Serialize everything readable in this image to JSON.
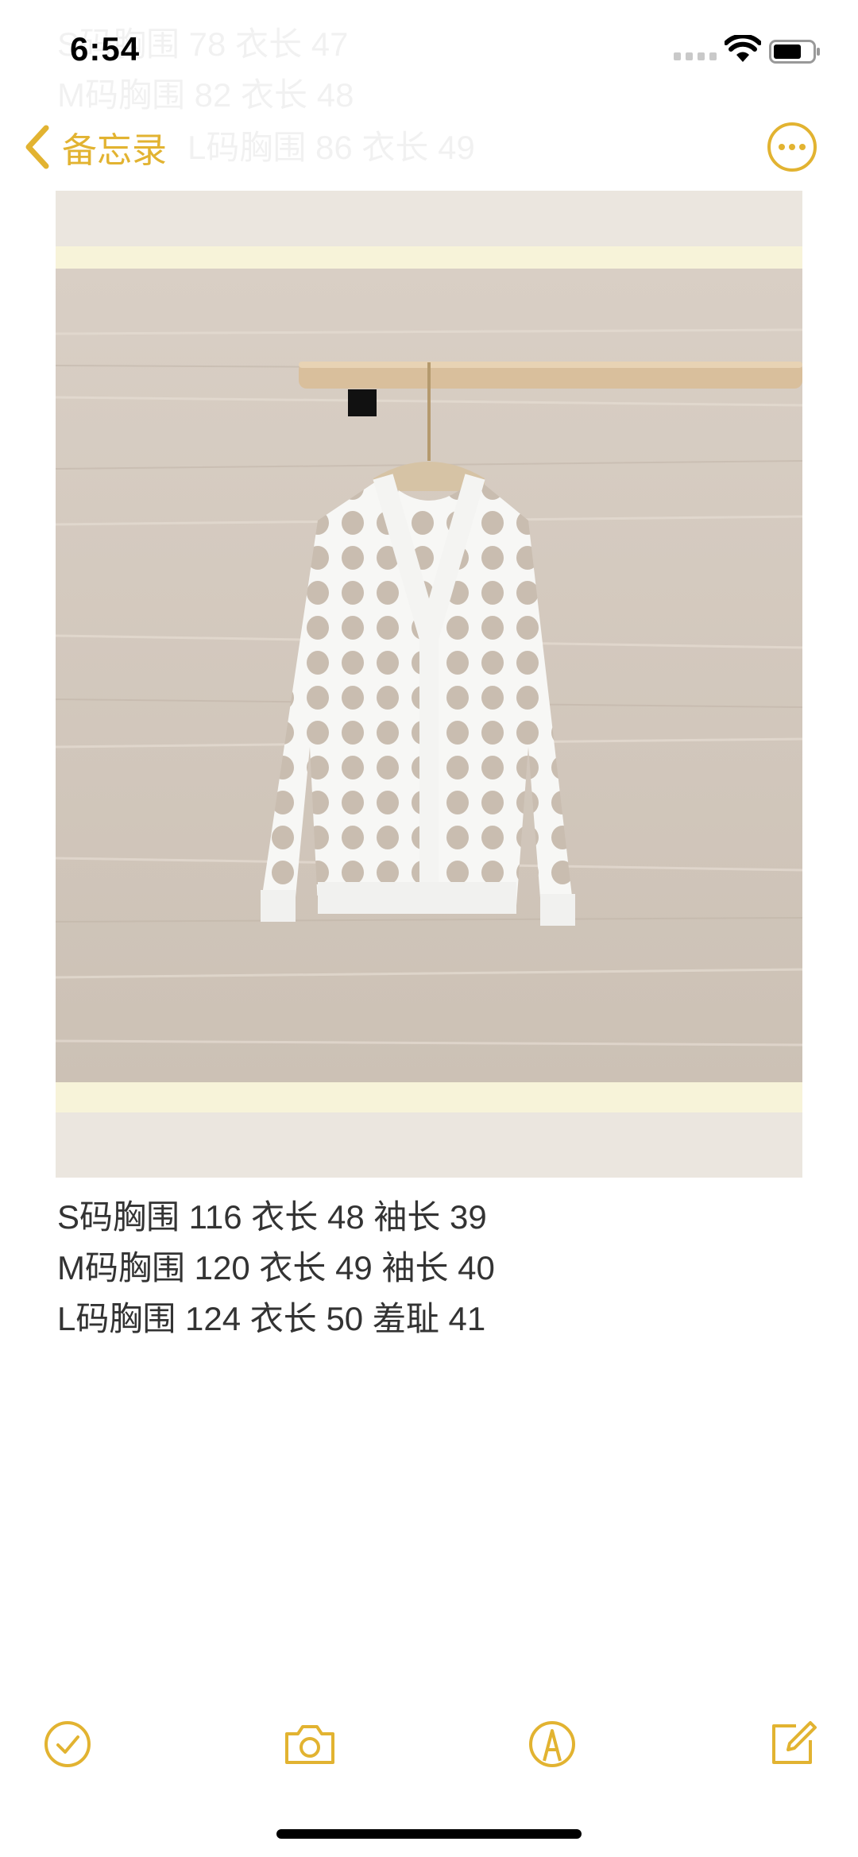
{
  "status_bar": {
    "time": "6:54"
  },
  "background_ghost_text": [
    "S码胸围 78 衣长 47",
    "M码胸围 82 衣长 48",
    "L码胸围 86 衣长 49"
  ],
  "nav": {
    "back_label": "备忘录",
    "accent_color": "#e2b331"
  },
  "photo": {
    "subject": "white open-knit V-neck cardigan on hanger"
  },
  "sizes": [
    "S码胸围 116 衣长 48 袖长 39",
    "M码胸围 120 衣长 49 袖长 40",
    "L码胸围 124 衣长 50 羞耻 41"
  ],
  "toolbar": {
    "icons": [
      "checklist-icon",
      "camera-icon",
      "markup-icon",
      "compose-icon"
    ]
  }
}
